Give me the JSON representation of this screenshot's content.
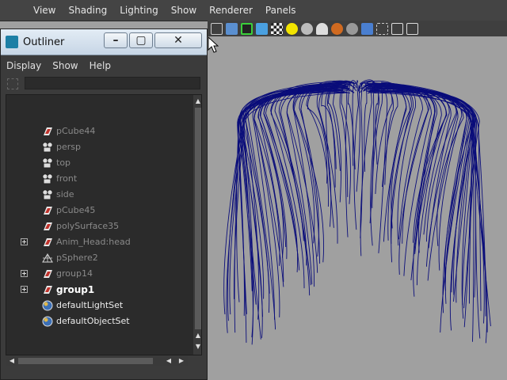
{
  "menubar": {
    "items": [
      "View",
      "Shading",
      "Lighting",
      "Show",
      "Renderer",
      "Panels"
    ]
  },
  "outliner": {
    "title": "Outliner",
    "menu": [
      "Display",
      "Show",
      "Help"
    ],
    "items": [
      {
        "label": "pCube44",
        "icon": "mesh-icon",
        "state": "dim",
        "expand": false
      },
      {
        "label": "persp",
        "icon": "camera-icon",
        "state": "dim",
        "expand": false
      },
      {
        "label": "top",
        "icon": "camera-icon",
        "state": "dim",
        "expand": false
      },
      {
        "label": "front",
        "icon": "camera-icon",
        "state": "dim",
        "expand": false
      },
      {
        "label": "side",
        "icon": "camera-icon",
        "state": "dim",
        "expand": false
      },
      {
        "label": "pCube45",
        "icon": "mesh-icon",
        "state": "dim",
        "expand": false
      },
      {
        "label": "polySurface35",
        "icon": "mesh-icon",
        "state": "dim",
        "expand": false
      },
      {
        "label": "Anim_Head:head",
        "icon": "mesh-icon",
        "state": "dim",
        "expand": true
      },
      {
        "label": "pSphere2",
        "icon": "locator-icon",
        "state": "dim",
        "expand": false
      },
      {
        "label": "group14",
        "icon": "mesh-icon",
        "state": "dim",
        "expand": true
      },
      {
        "label": "group1",
        "icon": "mesh-icon",
        "state": "strong",
        "expand": true
      },
      {
        "label": "defaultLightSet",
        "icon": "set-icon",
        "state": "bright",
        "expand": false
      },
      {
        "label": "defaultObjectSet",
        "icon": "set-icon",
        "state": "bright",
        "expand": false
      }
    ]
  },
  "colors": {
    "hair": "#0a0d7a",
    "viewport": "#a0a0a0",
    "panel": "#2b2b2b"
  }
}
